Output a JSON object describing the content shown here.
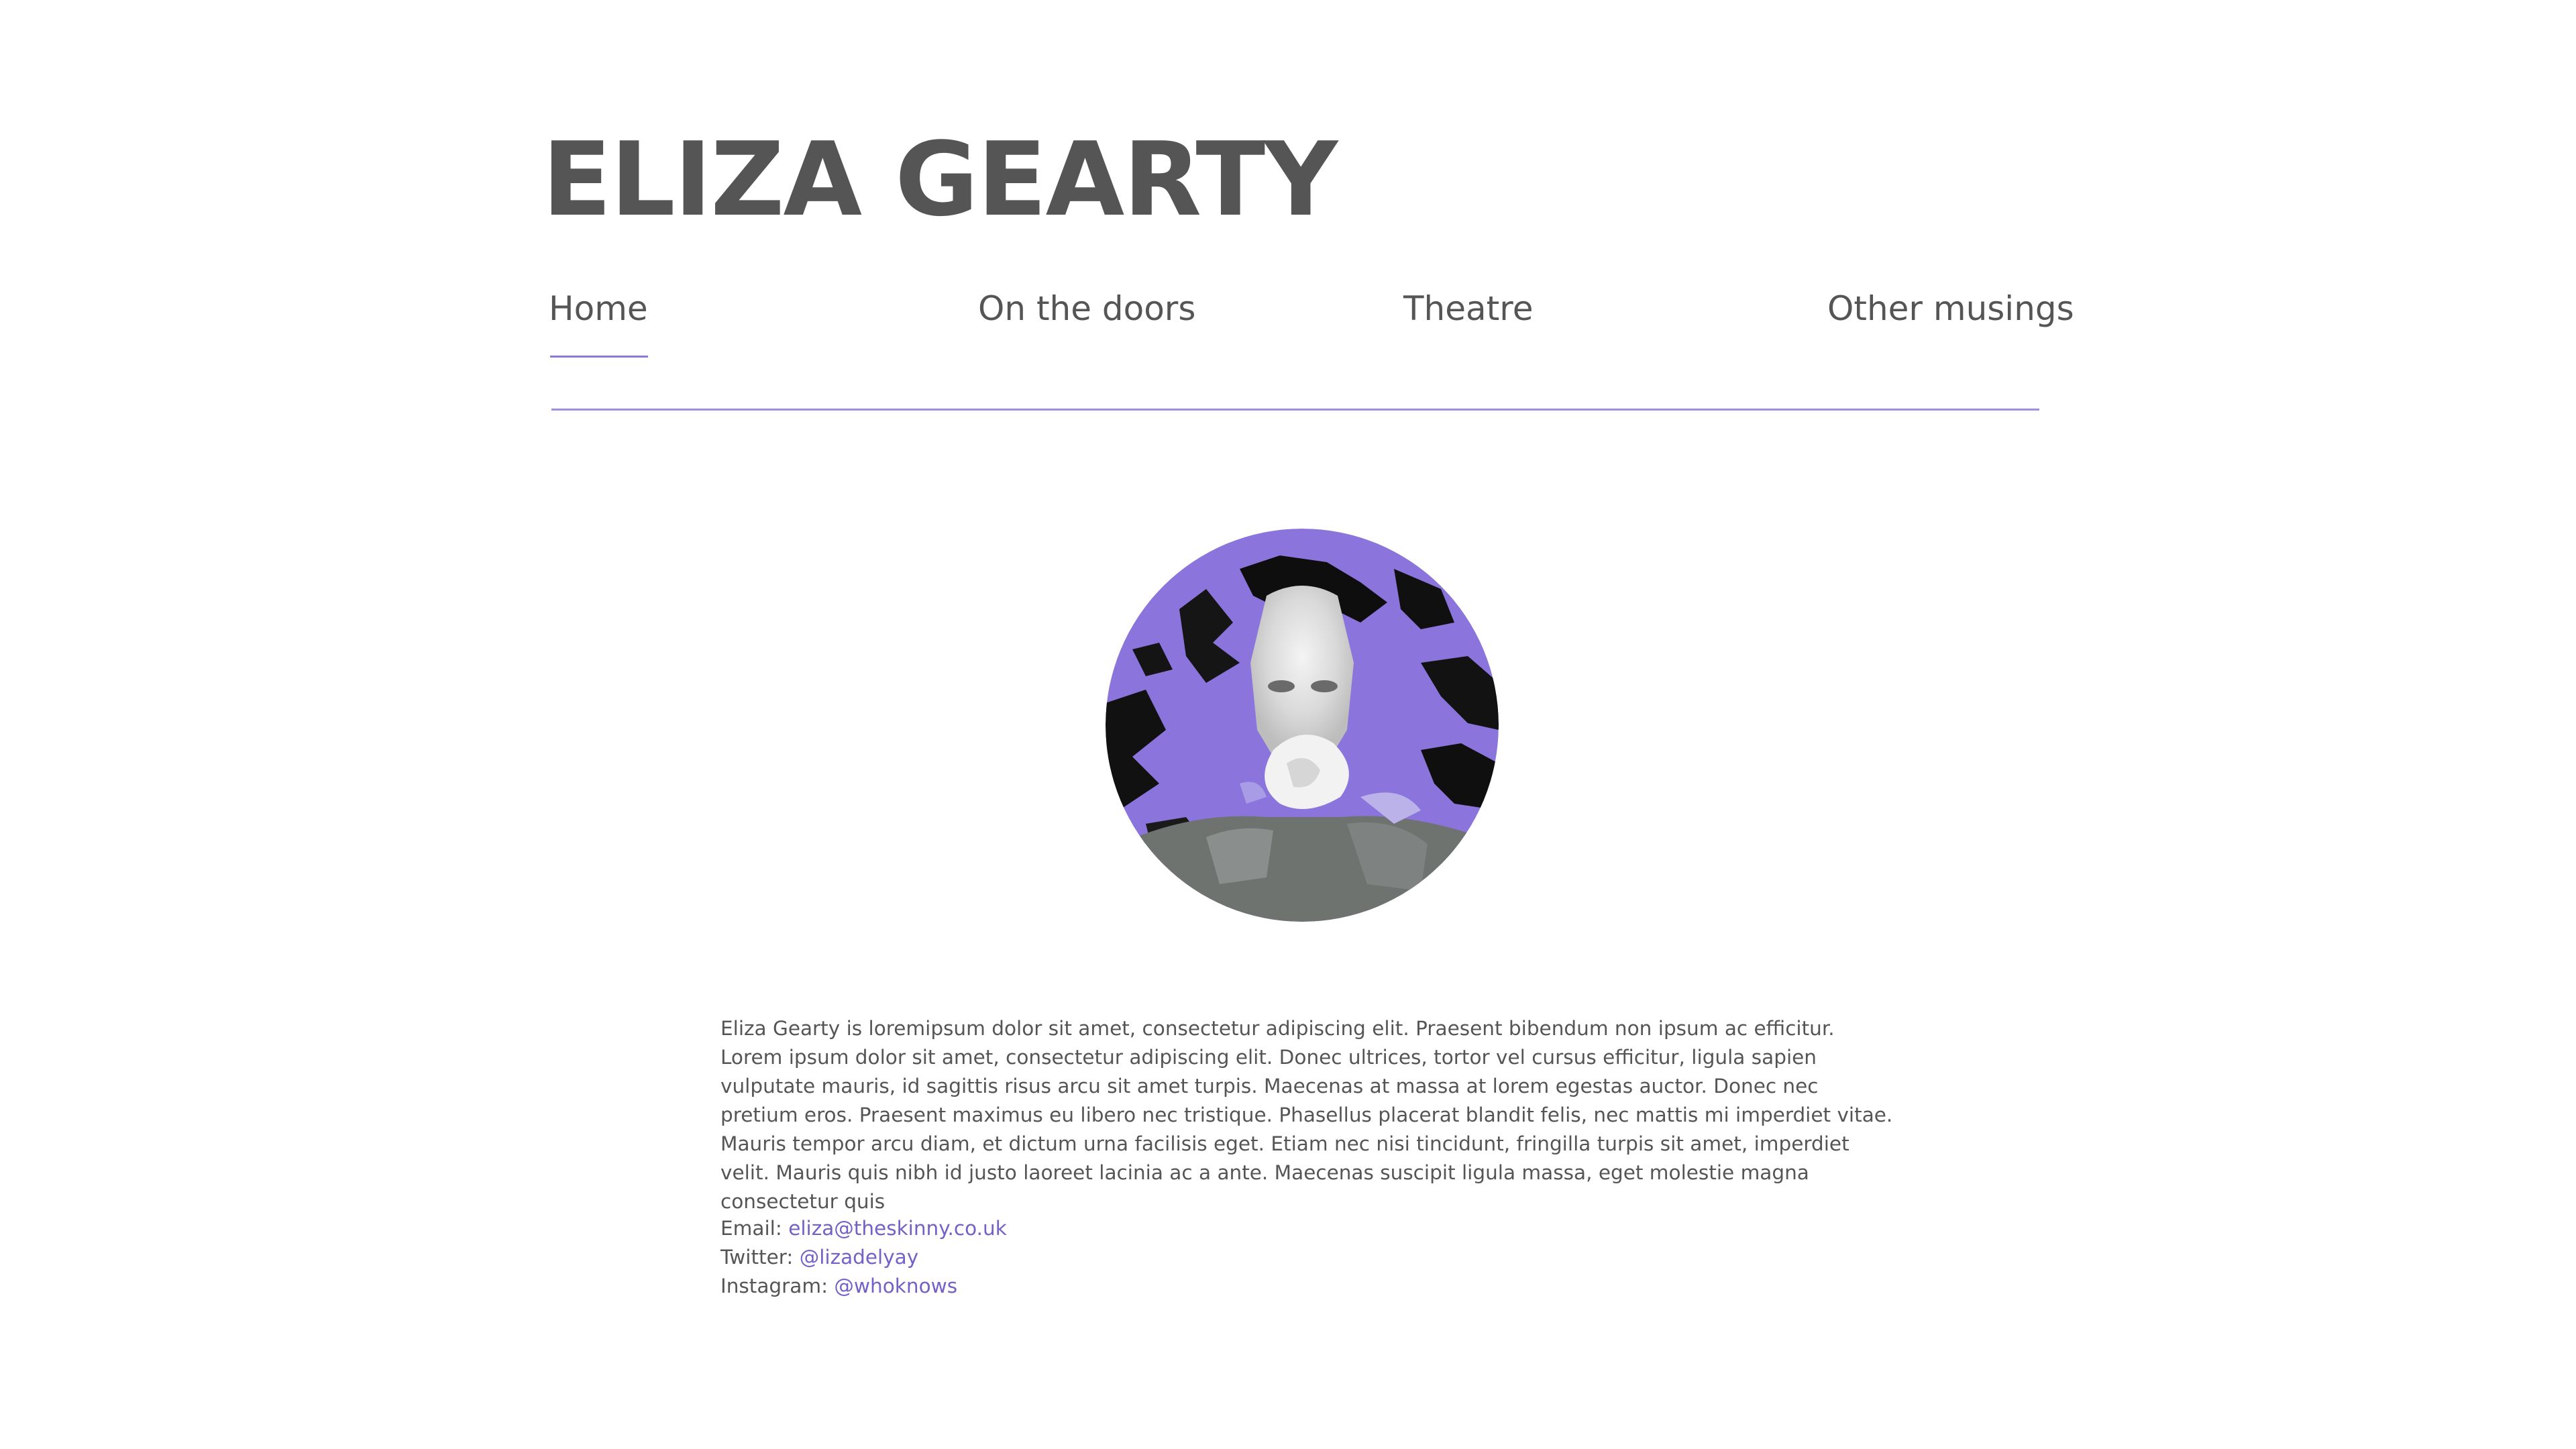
{
  "header": {
    "title": "ELIZA GEARTY"
  },
  "nav": {
    "items": [
      {
        "label": "Home",
        "active": true
      },
      {
        "label": "On the doors",
        "active": false
      },
      {
        "label": "Theatre",
        "active": false
      },
      {
        "label": "Other musings",
        "active": false
      }
    ]
  },
  "profile": {
    "photo_icon": "portrait-photo",
    "bio": "Eliza Gearty is loremipsum dolor sit amet, consectetur adipiscing elit. Praesent bibendum non ipsum ac efficitur. Lorem ipsum dolor sit amet, consectetur adipiscing elit. Donec ultrices, tortor vel cursus efficitur, ligula sapien vulputate mauris, id sagittis risus arcu sit amet turpis. Maecenas at massa at lorem egestas auctor. Donec nec pretium eros. Praesent maximus eu libero nec tristique. Phasellus placerat blandit felis, nec mattis mi imperdiet vitae. Mauris tempor arcu diam, et dictum urna facilisis eget. Etiam nec nisi tincidunt, fringilla turpis sit amet, imperdiet velit. Mauris quis nibh id justo laoreet lacinia ac a ante. Maecenas suscipit ligula massa, eget molestie magna consectetur quis"
  },
  "contacts": {
    "email": {
      "label": "Email:",
      "value": "eliza@theskinny.co.uk"
    },
    "twitter": {
      "label": "Twitter:",
      "value": "@lizadelyay"
    },
    "instagram": {
      "label": "Instagram:",
      "value": "@whoknows"
    }
  },
  "colors": {
    "accent": "#8a7bd6",
    "link": "#7560c8",
    "text": "#555555"
  }
}
